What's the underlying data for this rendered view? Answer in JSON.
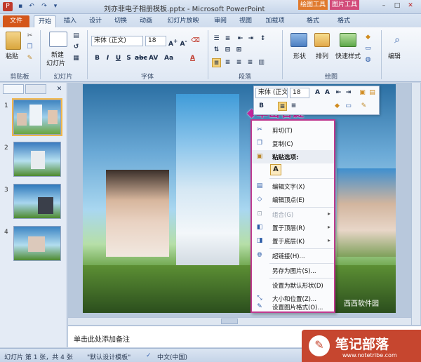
{
  "window": {
    "title": "刘亦菲电子相册模板.pptx - Microsoft PowerPoint",
    "context_tabs": [
      "绘图工具",
      "图片工具"
    ]
  },
  "tabs": [
    "文件",
    "开始",
    "插入",
    "设计",
    "切换",
    "动画",
    "幻灯片放映",
    "审阅",
    "视图",
    "加载项",
    "格式",
    "格式"
  ],
  "ribbon": {
    "clipboard": {
      "paste": "粘贴",
      "group": "剪贴板"
    },
    "slides": {
      "new_slide_1": "新建",
      "new_slide_2": "幻灯片",
      "group": "幻灯片"
    },
    "font": {
      "font_name": "宋体 (正文)",
      "font_size": "18",
      "group": "字体"
    },
    "paragraph": {
      "group": "段落"
    },
    "drawing": {
      "shape": "形状",
      "arrange": "排列",
      "quick_styles": "快速样式",
      "group": "绘图"
    },
    "editing": {
      "edit": "编辑"
    }
  },
  "left_panel": {
    "slides": [
      {
        "num": "1"
      },
      {
        "num": "2"
      },
      {
        "num": "3"
      },
      {
        "num": "4"
      }
    ]
  },
  "mini_toolbar": {
    "font_name": "宋体 (正文)",
    "font_size": "18"
  },
  "annotation": "◆单击右键",
  "context_menu": {
    "items": [
      {
        "label": "剪切(T)",
        "icon": "cut-icon",
        "enabled": true
      },
      {
        "label": "复制(C)",
        "icon": "copy-icon",
        "enabled": true
      },
      {
        "label": "粘贴选项:",
        "icon": "paste-icon",
        "enabled": true
      },
      {
        "label": "编辑文字(X)",
        "icon": "edit-text-icon",
        "enabled": true
      },
      {
        "label": "编辑顶点(E)",
        "icon": "edit-points-icon",
        "enabled": true
      },
      {
        "label": "组合(G)",
        "icon": "group-icon",
        "enabled": false
      },
      {
        "label": "置于顶层(R)",
        "icon": "bring-front-icon",
        "enabled": true
      },
      {
        "label": "置于底层(K)",
        "icon": "send-back-icon",
        "enabled": true
      },
      {
        "label": "超链接(H)...",
        "icon": "hyperlink-icon",
        "enabled": true
      },
      {
        "label": "另存为图片(S)...",
        "icon": "",
        "enabled": true
      },
      {
        "label": "设置为默认形状(D)",
        "icon": "",
        "enabled": true
      },
      {
        "label": "大小和位置(Z)...",
        "icon": "size-icon",
        "enabled": true
      },
      {
        "label": "设置图片格式(O)...",
        "icon": "format-icon",
        "enabled": true
      }
    ]
  },
  "notes": {
    "placeholder": "单击此处添加备注"
  },
  "status": {
    "slide_info": "幻灯片 第 1 张，共 4 张",
    "theme": "\"默认设计模板\"",
    "language": "中文(中国)"
  },
  "slide_text": {
    "corner": "西西软件园"
  },
  "watermark": {
    "title": "笔记部落",
    "url": "www.notetribe.com"
  },
  "colors": {
    "file_tab": "#d4561a",
    "context_tab_drawing": "#e07a2e",
    "context_tab_picture": "#d24b7a",
    "menu_border": "#c0398f"
  }
}
